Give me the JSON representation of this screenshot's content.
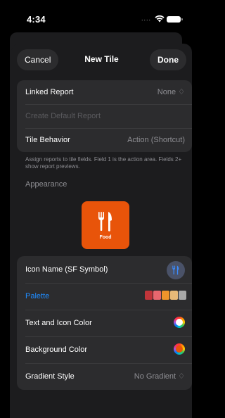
{
  "status": {
    "time": "4:34",
    "signal_dots": "...."
  },
  "nav": {
    "cancel_label": "Cancel",
    "title": "New Tile",
    "done_label": "Done"
  },
  "report_group": {
    "linked_report_label": "Linked Report",
    "linked_report_value": "None ♢",
    "create_default_label": "Create Default Report",
    "tile_behavior_label": "Tile Behavior",
    "tile_behavior_value": "Action (Shortcut)"
  },
  "footnote": "Assign reports to tile fields. Field 1 is the action area. Fields 2+ show report previews.",
  "appearance": {
    "header": "Appearance",
    "tile": {
      "label": "Food",
      "color": "#e8540a",
      "icon": "fork-knife-icon"
    }
  },
  "style_group": {
    "icon_name_label": "Icon Name (SF Symbol)",
    "palette_label": "Palette",
    "palette_colors": [
      "#c0353a",
      "#e8676e",
      "#f0942b",
      "#e7b978",
      "#a8a8a8"
    ],
    "text_icon_color_label": "Text and Icon Color",
    "background_color_label": "Background Color",
    "gradient_style_label": "Gradient Style",
    "gradient_style_value": "No Gradient ♢"
  }
}
